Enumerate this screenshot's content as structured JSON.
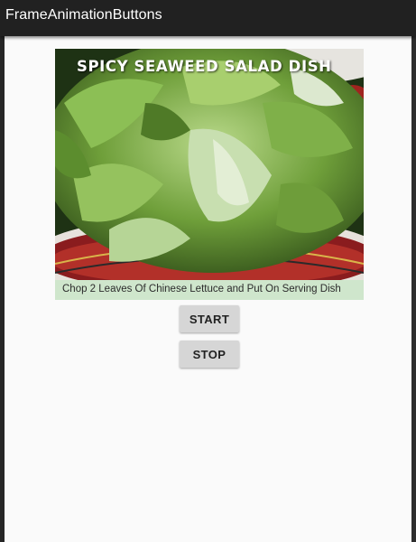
{
  "app_bar": {
    "title": "FrameAnimationButtons"
  },
  "animation_frame": {
    "dish_title": "SPICY SEAWEED SALAD DISH",
    "caption": "Chop  2 Leaves Of Chinese Lettuce and Put On Serving Dish",
    "caption_bg": "#cfe6cc"
  },
  "buttons": {
    "start": "START",
    "stop": "STOP"
  },
  "colors": {
    "app_bar": "#212121",
    "background": "#fafafa",
    "button": "#d6d6d6"
  }
}
